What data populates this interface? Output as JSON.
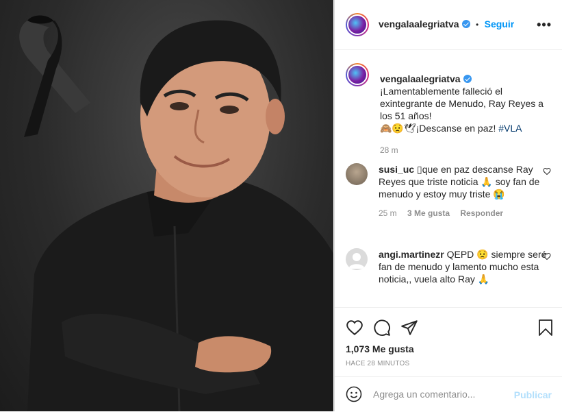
{
  "post": {
    "username": "vengalaalegriatva",
    "follow_label": "Seguir",
    "dot_separator": "•",
    "more_label": "•••"
  },
  "caption": {
    "username": "vengalaalegriatva",
    "line1": "¡Lamentablemente falleció el exintegrante de Menudo, Ray Reyes a los 51 años!",
    "emojis": "🙈😟🕊",
    "line2": "¡Descanse en paz!",
    "hashtag": "#VLA",
    "time": "28 m"
  },
  "comments": [
    {
      "username": "susi_uc",
      "text": "▯que en paz descanse Ray Reyes que triste noticia 🙏 soy fan de menudo y estoy muy triste 😭",
      "time": "25 m",
      "likes": "3 Me gusta",
      "reply": "Responder"
    },
    {
      "username": "angi.martinezr",
      "text": "QEPD 😟 siempre seré fan de menudo y lamento mucho esta noticia,, vuela alto Ray 🙏"
    }
  ],
  "actions": {
    "likes": "1,073 Me gusta",
    "time": "HACE 28 MINUTOS"
  },
  "composer": {
    "placeholder": "Agrega un comentario...",
    "publish": "Publicar"
  },
  "colors": {
    "accent": "#0095f6",
    "publish_disabled": "#b2dffc",
    "muted": "#8e8e8e",
    "text": "#262626"
  }
}
